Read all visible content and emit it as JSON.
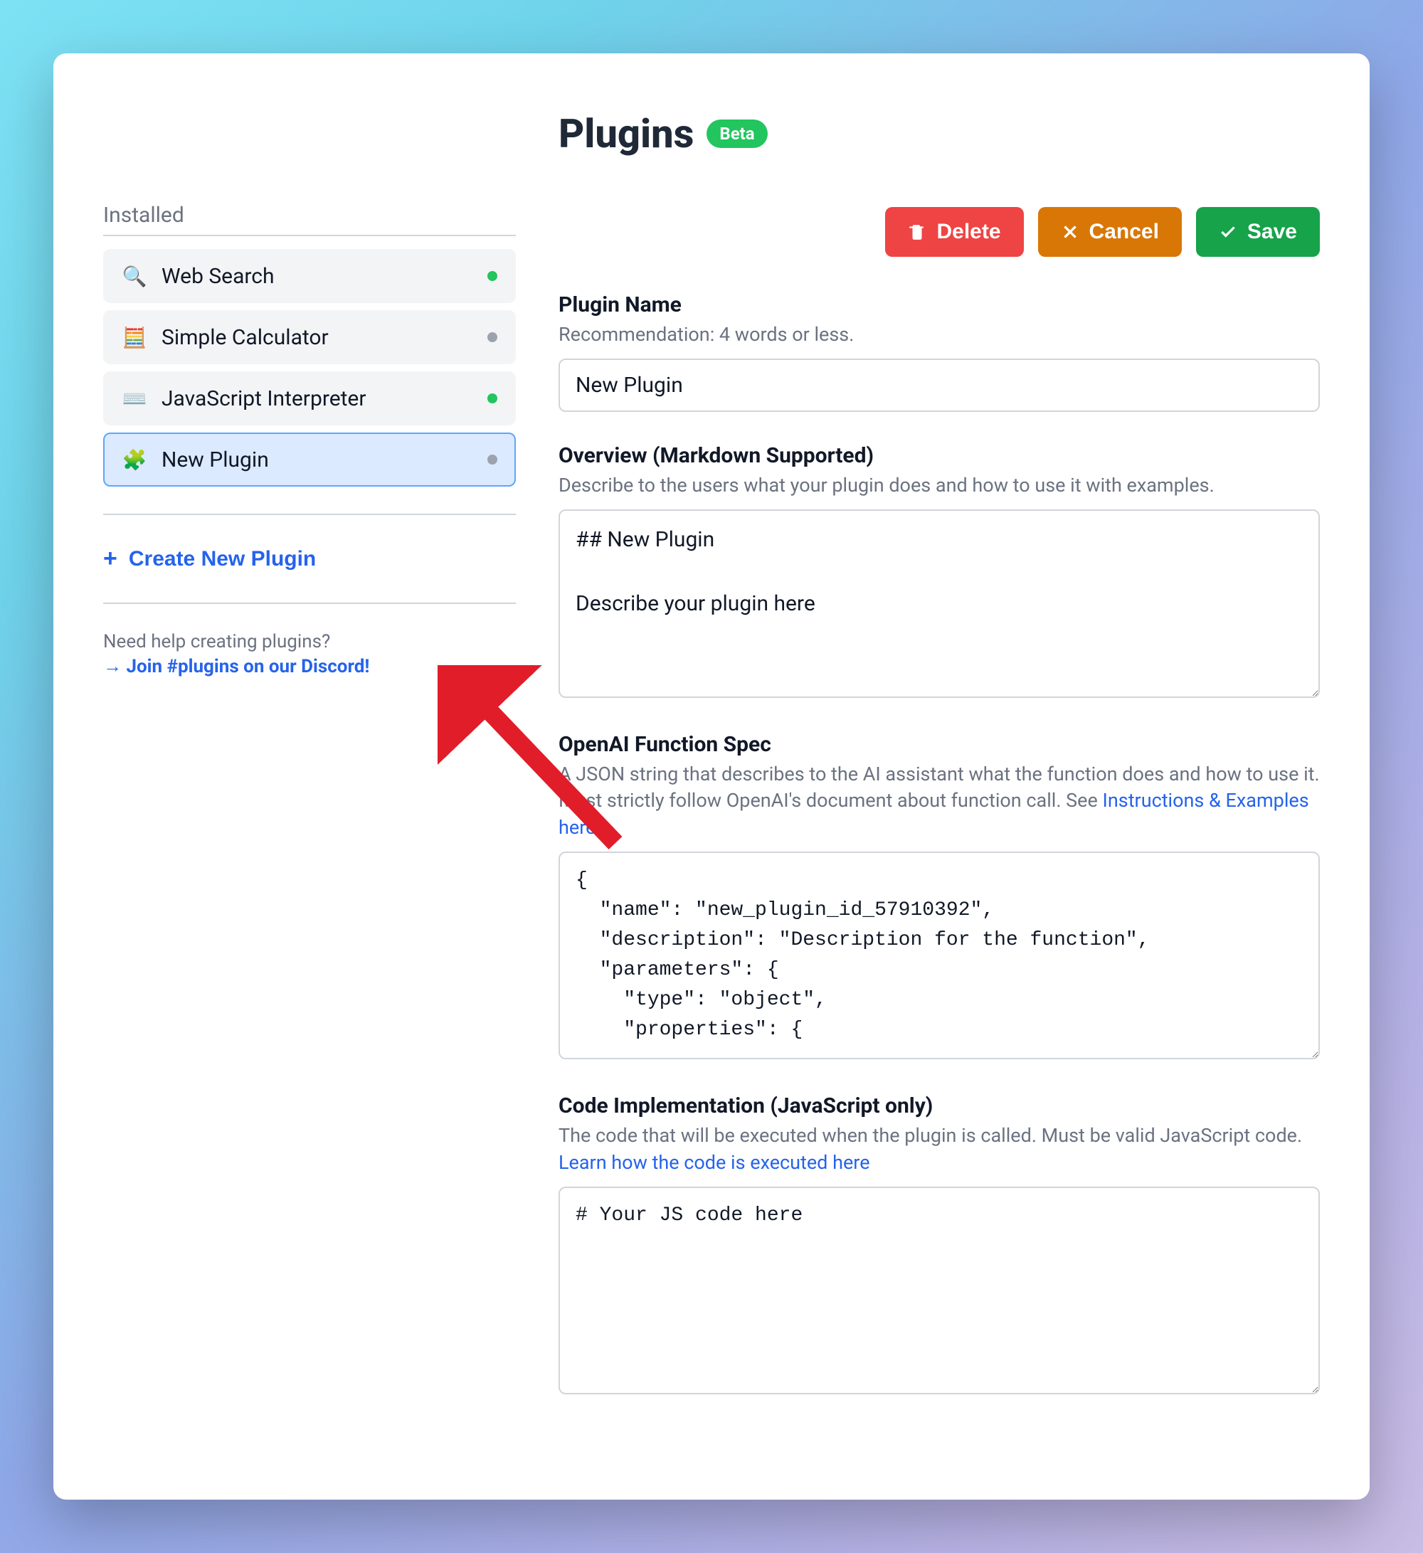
{
  "header": {
    "title": "Plugins",
    "badge": "Beta"
  },
  "sidebar": {
    "installed_label": "Installed",
    "items": [
      {
        "icon": "🔍",
        "label": "Web Search",
        "status": "green"
      },
      {
        "icon": "🧮",
        "label": "Simple Calculator",
        "status": "gray"
      },
      {
        "icon": "⌨️",
        "label": "JavaScript Interpreter",
        "status": "green"
      },
      {
        "icon": "🧩",
        "label": "New Plugin",
        "status": "gray"
      }
    ],
    "create_label": "Create New Plugin",
    "help_question": "Need help creating plugins?",
    "help_link": "→ Join #plugins on our Discord!"
  },
  "actions": {
    "delete": "Delete",
    "cancel": "Cancel",
    "save": "Save"
  },
  "form": {
    "name_label": "Plugin Name",
    "name_help": "Recommendation: 4 words or less.",
    "name_value": "New Plugin",
    "overview_label": "Overview (Markdown Supported)",
    "overview_help": "Describe to the users what your plugin does and how to use it with examples.",
    "overview_value": "## New Plugin\n\nDescribe your plugin here",
    "spec_label": "OpenAI Function Spec",
    "spec_help_pre": "A JSON string that describes to the AI assistant what the function does and how to use it. Must strictly follow OpenAI's document about function call. See ",
    "spec_help_link": "Instructions & Examples here",
    "spec_help_post": ".",
    "spec_value": "{\n  \"name\": \"new_plugin_id_57910392\",\n  \"description\": \"Description for the function\",\n  \"parameters\": {\n    \"type\": \"object\",\n    \"properties\": {",
    "code_label": "Code Implementation (JavaScript only)",
    "code_help_pre": "The code that will be executed when the plugin is called. Must be valid JavaScript code. ",
    "code_help_link": "Learn how the code is executed here",
    "code_value": "# Your JS code here"
  }
}
